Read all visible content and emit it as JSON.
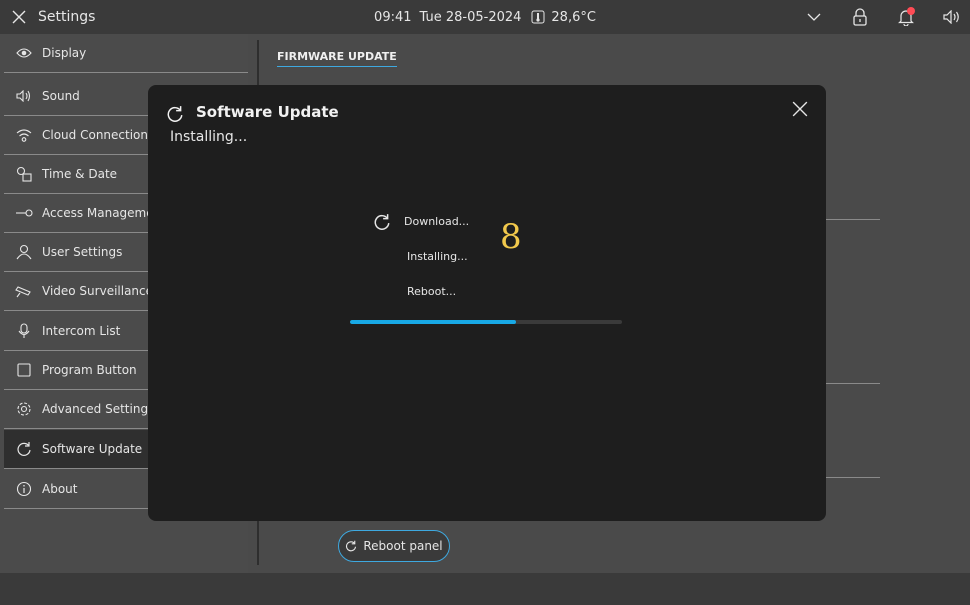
{
  "topbar": {
    "title": "Settings",
    "time": "09:41",
    "date": "Tue 28-05-2024",
    "temperature": "28,6°C"
  },
  "sidebar": {
    "items": [
      {
        "label": "Display",
        "icon": "eye-icon"
      },
      {
        "label": "Sound",
        "icon": "speaker-icon"
      },
      {
        "label": "Cloud Connections",
        "icon": "wifi-icon"
      },
      {
        "label": "Time & Date",
        "icon": "calendar-clock-icon"
      },
      {
        "label": "Access Manageme",
        "icon": "key-icon"
      },
      {
        "label": "User Settings",
        "icon": "user-icon"
      },
      {
        "label": "Video Surveillance",
        "icon": "camera-icon"
      },
      {
        "label": "Intercom List",
        "icon": "microphone-icon"
      },
      {
        "label": "Program Button",
        "icon": "square-icon"
      },
      {
        "label": "Advanced Settings",
        "icon": "gear-icon"
      },
      {
        "label": "Software Update",
        "icon": "refresh-icon",
        "active": true
      },
      {
        "label": "About",
        "icon": "info-icon"
      }
    ]
  },
  "main": {
    "section_title": "FIRMWARE UPDATE",
    "reboot_label": "Reboot panel"
  },
  "modal": {
    "title": "Software Update",
    "subtitle": "Installing...",
    "steps": [
      "Download...",
      "Installing...",
      "Reboot..."
    ],
    "countdown": "8",
    "progress": 0.61
  },
  "colors": {
    "accent": "#18a9e6",
    "countdown": "#f2c94c",
    "notification": "#ff4b55"
  }
}
